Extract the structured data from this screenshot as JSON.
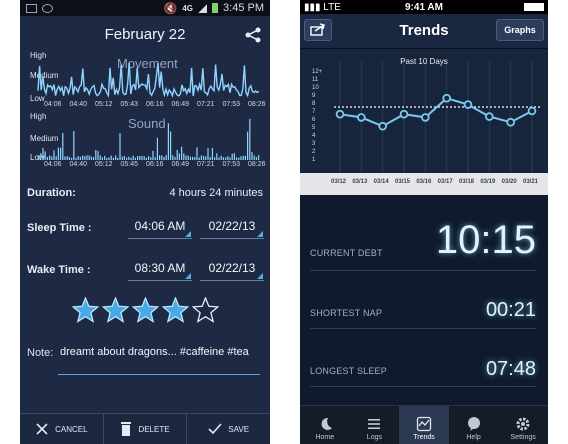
{
  "left": {
    "status": {
      "time": "3:45 PM",
      "network": "4G"
    },
    "title": "February 22",
    "movement": {
      "title": "Movement",
      "levels": [
        "High",
        "Medium",
        "Low"
      ],
      "ticks": [
        "04:06",
        "04:40",
        "05:12",
        "05:43",
        "06:16",
        "06:49",
        "07:21",
        "07:53",
        "08:26"
      ]
    },
    "sound": {
      "title": "Sound",
      "levels": [
        "High",
        "Medium",
        "Low"
      ],
      "ticks": [
        "04:06",
        "04:40",
        "05:12",
        "05:45",
        "06:16",
        "06:49",
        "07:21",
        "07:53",
        "08:26"
      ]
    },
    "duration": {
      "label": "Duration:",
      "value": "4 hours 24 minutes"
    },
    "sleep": {
      "label": "Sleep Time :",
      "time": "04:06 AM",
      "date": "02/22/13"
    },
    "wake": {
      "label": "Wake Time :",
      "time": "08:30 AM",
      "date": "02/22/13"
    },
    "rating": {
      "filled": 4,
      "total": 5,
      "color": "#47a9e6"
    },
    "note": {
      "label": "Note:",
      "text": "dreamt about dragons... #caffeine #tea"
    },
    "actions": {
      "cancel": "CANCEL",
      "delete": "DELETE",
      "save": "SAVE"
    }
  },
  "right": {
    "status": {
      "carrier": "LTE",
      "time": "9:41 AM"
    },
    "title": "Trends",
    "graphs_button": "Graphs",
    "chart_data": {
      "type": "line",
      "title": "Past 10 Days",
      "x": [
        "03/12",
        "03/13",
        "03/14",
        "03/15",
        "03/16",
        "03/17",
        "03/18",
        "03/19",
        "03/20",
        "03/21"
      ],
      "y_ticks": [
        "12+",
        "11",
        "10",
        "9",
        "8",
        "7",
        "6",
        "5",
        "4",
        "3",
        "2",
        "1"
      ],
      "series": [
        {
          "values": [
            6.6,
            6.2,
            5.1,
            6.6,
            6.2,
            8.6,
            7.8,
            6.3,
            5.6,
            7.0
          ]
        }
      ],
      "average_line": 7.5,
      "ylim": [
        0,
        12
      ],
      "line_color": "#7cc8ee"
    },
    "stats": [
      {
        "label": "CURRENT DEBT",
        "value": "10:15"
      },
      {
        "label": "SHORTEST NAP",
        "value": "00:21"
      },
      {
        "label": "LONGEST SLEEP",
        "value": "07:48"
      }
    ],
    "tabs": [
      {
        "label": "Home",
        "icon": "moon-icon"
      },
      {
        "label": "Logs",
        "icon": "list-icon"
      },
      {
        "label": "Trends",
        "icon": "trend-icon"
      },
      {
        "label": "Help",
        "icon": "chat-icon"
      },
      {
        "label": "Settings",
        "icon": "gear-icon"
      }
    ]
  }
}
